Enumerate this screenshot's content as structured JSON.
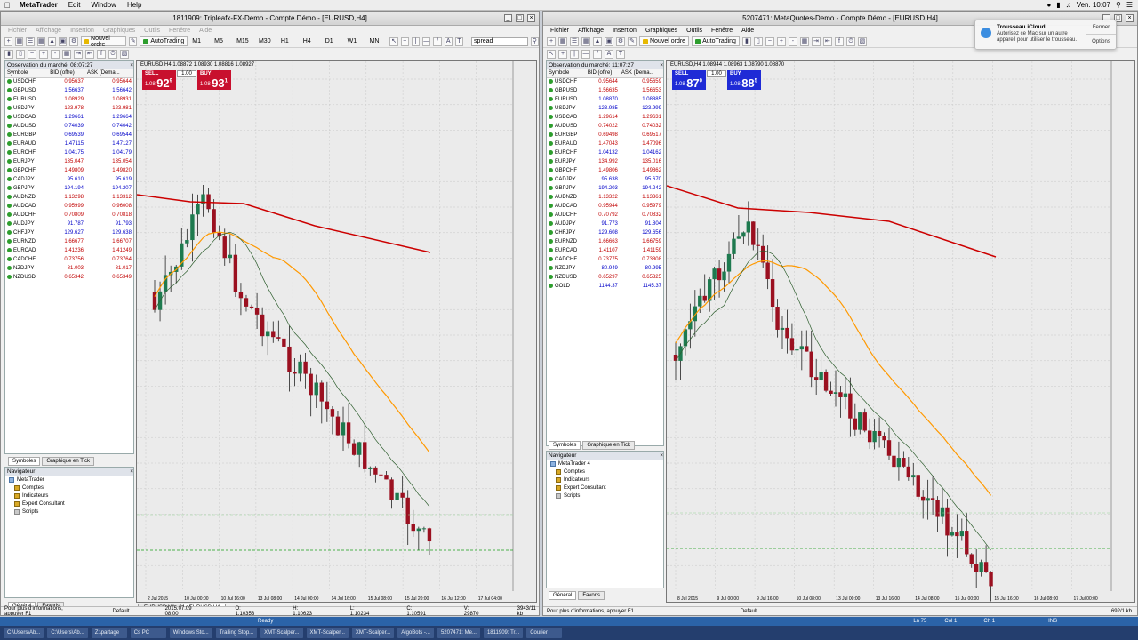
{
  "macbar": {
    "app": "MetaTrader",
    "menus": [
      "Edit",
      "Window",
      "Help"
    ],
    "clock": "Ven. 10:07"
  },
  "left": {
    "title": "1811909: Tripleafx-FX-Demo - Compte Démo - [EURUSD,H4]",
    "menu": [
      "Fichier",
      "Affichage",
      "Insertion",
      "Graphiques",
      "Outils",
      "Fenêtre",
      "Aide"
    ],
    "toolbar": {
      "new_order": "Nouvel ordre",
      "autotrading": "AutoTrading",
      "timeframes": [
        "M1",
        "M5",
        "M15",
        "M30",
        "H1",
        "H4",
        "D1",
        "W1",
        "MN"
      ],
      "search": "spread"
    },
    "mw_title": "Observation du marché: 08:07:27",
    "headers": [
      "Symbole",
      "BID (offre)",
      "ASK (Dema..."
    ],
    "rows": [
      {
        "s": "USDCHF",
        "b": "0.95637",
        "a": "0.95644",
        "up": false
      },
      {
        "s": "GBPUSD",
        "b": "1.56637",
        "a": "1.56642",
        "up": true
      },
      {
        "s": "EURUSD",
        "b": "1.08929",
        "a": "1.08931",
        "up": false
      },
      {
        "s": "USDJPY",
        "b": "123.978",
        "a": "123.981",
        "up": false
      },
      {
        "s": "USDCAD",
        "b": "1.29661",
        "a": "1.29664",
        "up": true
      },
      {
        "s": "AUDUSD",
        "b": "0.74039",
        "a": "0.74042",
        "up": true
      },
      {
        "s": "EURGBP",
        "b": "0.69539",
        "a": "0.69544",
        "up": true
      },
      {
        "s": "EURAUD",
        "b": "1.47115",
        "a": "1.47127",
        "up": true
      },
      {
        "s": "EURCHF",
        "b": "1.04175",
        "a": "1.04179",
        "up": true
      },
      {
        "s": "EURJPY",
        "b": "135.047",
        "a": "135.054",
        "up": false
      },
      {
        "s": "GBPCHF",
        "b": "1.49809",
        "a": "1.49820",
        "up": false
      },
      {
        "s": "CADJPY",
        "b": "95.610",
        "a": "95.619",
        "up": true
      },
      {
        "s": "GBPJPY",
        "b": "194.194",
        "a": "194.207",
        "up": true
      },
      {
        "s": "AUDNZD",
        "b": "1.13298",
        "a": "1.13312",
        "up": false
      },
      {
        "s": "AUDCAD",
        "b": "0.95999",
        "a": "0.96008",
        "up": false
      },
      {
        "s": "AUDCHF",
        "b": "0.70809",
        "a": "0.70818",
        "up": false
      },
      {
        "s": "AUDJPY",
        "b": "91.787",
        "a": "91.793",
        "up": true
      },
      {
        "s": "CHFJPY",
        "b": "129.627",
        "a": "129.638",
        "up": true
      },
      {
        "s": "EURNZD",
        "b": "1.66677",
        "a": "1.66707",
        "up": false
      },
      {
        "s": "EURCAD",
        "b": "1.41236",
        "a": "1.41249",
        "up": false
      },
      {
        "s": "CADCHF",
        "b": "0.73756",
        "a": "0.73764",
        "up": false
      },
      {
        "s": "NZDJPY",
        "b": "81.003",
        "a": "81.017",
        "up": false
      },
      {
        "s": "NZDUSD",
        "b": "0.65342",
        "a": "0.65349",
        "up": false
      }
    ],
    "mw_tabs": [
      "Symboles",
      "Graphique en Tick"
    ],
    "nav_title": "Navigateur",
    "nav": [
      "MetaTrader",
      "Comptes",
      "Indicateurs",
      "Expert Consultant",
      "Scripts"
    ],
    "nav_tabs": [
      "Général",
      "Favoris"
    ],
    "chart_label": "EURUSD,H4 1.08872 1.08930 1.08816 1.08927",
    "sell": "SELL",
    "buy": "BUY",
    "lot": "1.00",
    "sell_prefix": "1.08",
    "sell_big": "92",
    "sell_sup": "9",
    "buy_prefix": "1.08",
    "buy_big": "93",
    "buy_sup": "1",
    "chart_tabs": [
      "EURUSD,H1",
      "EURUSD,H4"
    ],
    "status": [
      "Pour plus d'informations, appuyer F1",
      "Default",
      "2015.07.09 08:00",
      "O: 1.10353",
      "H: 1.10623",
      "L: 1.10234",
      "C: 1.10591",
      "V: 29870",
      "3943/11 kb"
    ],
    "axis_dates": [
      "2 Jul 2015",
      "10 Jul 00:00",
      "10 Jul 16:00",
      "13 Jul 08:00",
      "14 Jul 00:00",
      "14 Jul 16:00",
      "15 Jul 08:00",
      "15 Jul 20:00",
      "16 Jul 12:00",
      "17 Jul 04:00"
    ]
  },
  "right": {
    "title": "5207471: MetaQuotes-Demo - Compte Démo - [EURUSD,H4]",
    "menu": [
      "Fichier",
      "Affichage",
      "Insertion",
      "Graphiques",
      "Outils",
      "Fenêtre",
      "Aide"
    ],
    "toolbar": {
      "new_order": "Nouvel ordre",
      "autotrading": "AutoTrading"
    },
    "mw_title": "Observation du marché: 11:07:27",
    "headers": [
      "Symbole",
      "BID (offre)",
      "ASK (Dema..."
    ],
    "rows": [
      {
        "s": "USDCHF",
        "b": "0.95644",
        "a": "0.95659",
        "up": false
      },
      {
        "s": "GBPUSD",
        "b": "1.56635",
        "a": "1.56653",
        "up": false
      },
      {
        "s": "EURUSD",
        "b": "1.08870",
        "a": "1.08885",
        "up": true
      },
      {
        "s": "USDJPY",
        "b": "123.985",
        "a": "123.999",
        "up": true
      },
      {
        "s": "USDCAD",
        "b": "1.29614",
        "a": "1.29631",
        "up": false
      },
      {
        "s": "AUDUSD",
        "b": "0.74022",
        "a": "0.74032",
        "up": false
      },
      {
        "s": "EURGBP",
        "b": "0.69498",
        "a": "0.69517",
        "up": false
      },
      {
        "s": "EURAUD",
        "b": "1.47043",
        "a": "1.47096",
        "up": false
      },
      {
        "s": "EURCHF",
        "b": "1.04132",
        "a": "1.04162",
        "up": true
      },
      {
        "s": "EURJPY",
        "b": "134.992",
        "a": "135.016",
        "up": false
      },
      {
        "s": "GBPCHF",
        "b": "1.49806",
        "a": "1.49862",
        "up": false
      },
      {
        "s": "CADJPY",
        "b": "95.638",
        "a": "95.670",
        "up": true
      },
      {
        "s": "GBPJPY",
        "b": "194.203",
        "a": "194.242",
        "up": true
      },
      {
        "s": "AUDNZD",
        "b": "1.13322",
        "a": "1.13361",
        "up": false
      },
      {
        "s": "AUDCAD",
        "b": "0.95944",
        "a": "0.95979",
        "up": false
      },
      {
        "s": "AUDCHF",
        "b": "0.70792",
        "a": "0.70832",
        "up": false
      },
      {
        "s": "AUDJPY",
        "b": "91.773",
        "a": "91.804",
        "up": true
      },
      {
        "s": "CHFJPY",
        "b": "129.608",
        "a": "129.656",
        "up": true
      },
      {
        "s": "EURNZD",
        "b": "1.66663",
        "a": "1.66759",
        "up": false
      },
      {
        "s": "EURCAD",
        "b": "1.41107",
        "a": "1.41159",
        "up": false
      },
      {
        "s": "CADCHF",
        "b": "0.73775",
        "a": "0.73808",
        "up": false
      },
      {
        "s": "NZDJPY",
        "b": "80.949",
        "a": "80.995",
        "up": true
      },
      {
        "s": "NZDUSD",
        "b": "0.65297",
        "a": "0.65325",
        "up": false
      },
      {
        "s": "GOLD",
        "b": "1144.37",
        "a": "1145.37",
        "up": true
      }
    ],
    "mw_tabs": [
      "Symboles",
      "Graphique en Tick"
    ],
    "nav_title": "Navigateur",
    "nav": [
      "MetaTrader 4",
      "Comptes",
      "Indicateurs",
      "Expert Consultant",
      "Scripts"
    ],
    "nav_tabs": [
      "Général",
      "Favoris"
    ],
    "chart_label": "EURUSD,H4 1.08944 1.08963 1.08790 1.08870",
    "sell": "SELL",
    "buy": "BUY",
    "lot": "1.00",
    "sell_prefix": "1.08",
    "sell_big": "87",
    "sell_sup": "0",
    "buy_prefix": "1.08",
    "buy_big": "88",
    "buy_sup": "5",
    "status": [
      "Pour plus d'informations, appuyer F1",
      "Default",
      "692/1 kb"
    ],
    "axis_dates": [
      "8 Jul 2015",
      "9 Jul 00:00",
      "9 Jul 16:00",
      "10 Jul 08:00",
      "13 Jul 00:00",
      "13 Jul 16:00",
      "14 Jul 08:00",
      "15 Jul 00:00",
      "15 Jul 16:00",
      "16 Jul 08:00",
      "17 Jul 00:00"
    ]
  },
  "notification": {
    "title": "Trousseau iCloud",
    "body": "Autorisez ce Mac sur un autre appareil pour utiliser le trousseau.",
    "close": "Fermer",
    "options": "Options"
  },
  "taskbar": {
    "status": [
      "Ready",
      "Ln 75",
      "Col 1",
      "Ch 1",
      "INS"
    ],
    "items": [
      "C:\\Users\\Ab...",
      "C:\\Users\\Ab...",
      "Z:\\partage",
      "Cs PC",
      "Windows Sto...",
      "Trailing Stop...",
      "XMT-Scalper...",
      "XMT-Scalper...",
      "XMT-Scalper...",
      "AlgoBots -...",
      "5207471: Me...",
      "1811909: Tr...",
      "Courier"
    ]
  },
  "colors": {
    "sell": "#c8102e",
    "buy": "#1f2bd6",
    "ma_long": "#cc0000",
    "ma_mid": "#ff9900",
    "ma_short": "#2e5e2e",
    "bull": "#1e7a4f",
    "bear": "#9b1020"
  }
}
